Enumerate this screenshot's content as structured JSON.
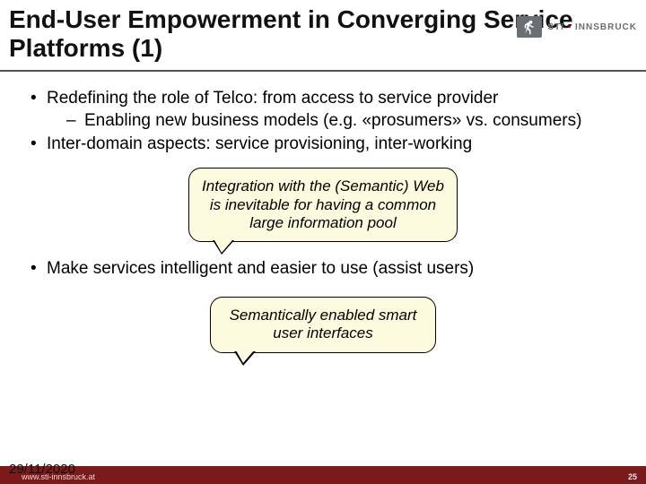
{
  "title": "End-User Empowerment in Converging Service Platforms (1)",
  "logo": {
    "text_left": "STI",
    "text_right": "INNSBRUCK"
  },
  "bullets": {
    "b1": "Redefining the role of Telco: from access to service provider",
    "b1_sub": "Enabling new business models (e.g. «prosumers» vs. consumers)",
    "b2": "Inter-domain aspects: service provisioning, inter-working",
    "b3": "Make services intelligent and easier to use (assist users)"
  },
  "callouts": {
    "c1": "Integration with the (Semantic) Web is inevitable for having a common large information pool",
    "c2": "Semantically enabled smart user interfaces"
  },
  "footer": {
    "date": "29/11/2020",
    "url": "www.sti-innsbruck.at",
    "page": "25"
  }
}
